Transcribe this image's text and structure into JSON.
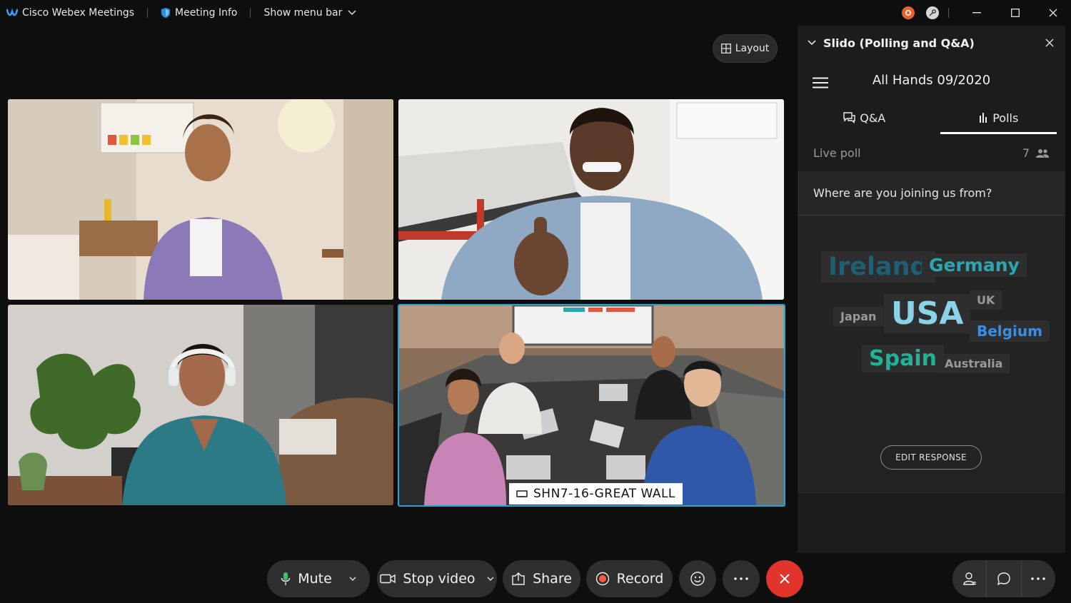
{
  "titlebar": {
    "app_name": "Cisco Webex Meetings",
    "meeting_info": "Meeting Info",
    "show_menu": "Show menu bar"
  },
  "stage": {
    "layout_label": "Layout",
    "active_room_name": "SHN7-16-GREAT WALL"
  },
  "slido": {
    "header_title": "Slido (Polling and Q&A)",
    "event_title": "All Hands 09/2020",
    "tabs": [
      {
        "label": "Q&A",
        "active": false
      },
      {
        "label": "Polls",
        "active": true
      }
    ],
    "live_poll_label": "Live poll",
    "participant_count": "7",
    "question": "Where are you joining us from?",
    "word_cloud": [
      {
        "word": "Ireland",
        "color": "#1f5f73"
      },
      {
        "word": "Germany",
        "color": "#2aa7b0"
      },
      {
        "word": "UK",
        "color": "#9a9a9a"
      },
      {
        "word": "Japan",
        "color": "#9a9a9a"
      },
      {
        "word": "USA",
        "color": "#8ad3e6"
      },
      {
        "word": "Belgium",
        "color": "#3c8fe0"
      },
      {
        "word": "Spain",
        "color": "#1fb39a"
      },
      {
        "word": "Australia",
        "color": "#9a9a9a"
      }
    ],
    "edit_response": "EDIT RESPONSE"
  },
  "controls": {
    "mute": "Mute",
    "stop_video": "Stop video",
    "share": "Share",
    "record": "Record"
  },
  "colors": {
    "end_call": "#e0342c",
    "active_border": "#27a3d4",
    "record_dot": "#ff5a3c"
  }
}
